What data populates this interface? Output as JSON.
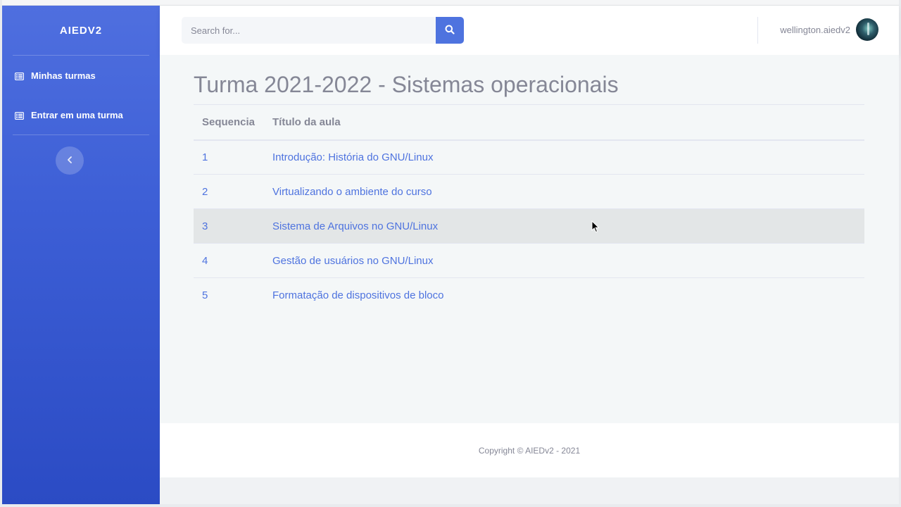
{
  "sidebar": {
    "brand": "AIEDV2",
    "items": [
      {
        "label": "Minhas turmas",
        "icon": "table-list-icon"
      },
      {
        "label": "Entrar em uma turma",
        "icon": "table-list-icon"
      }
    ],
    "toggle_icon": "chevron-left-icon"
  },
  "topbar": {
    "search_placeholder": "Search for...",
    "search_icon": "search-icon",
    "user_name": "wellington.aiedv2"
  },
  "main": {
    "title": "Turma 2021-2022 - Sistemas operacionais",
    "table": {
      "headers": [
        "Sequencia",
        "Título da aula"
      ],
      "rows": [
        {
          "seq": "1",
          "title": "Introdução: História do GNU/Linux"
        },
        {
          "seq": "2",
          "title": "Virtualizando o ambiente do curso"
        },
        {
          "seq": "3",
          "title": "Sistema de Arquivos no GNU/Linux"
        },
        {
          "seq": "4",
          "title": "Gestão de usuários no GNU/Linux"
        },
        {
          "seq": "5",
          "title": "Formatação de dispositivos de bloco"
        }
      ]
    }
  },
  "footer": {
    "copyright": "Copyright © AIEDv2 - 2021"
  },
  "colors": {
    "primary": "#4e73df",
    "sidebar_top": "#4f6fdf",
    "sidebar_bottom": "#2b4bc4",
    "text_muted": "#858796"
  }
}
